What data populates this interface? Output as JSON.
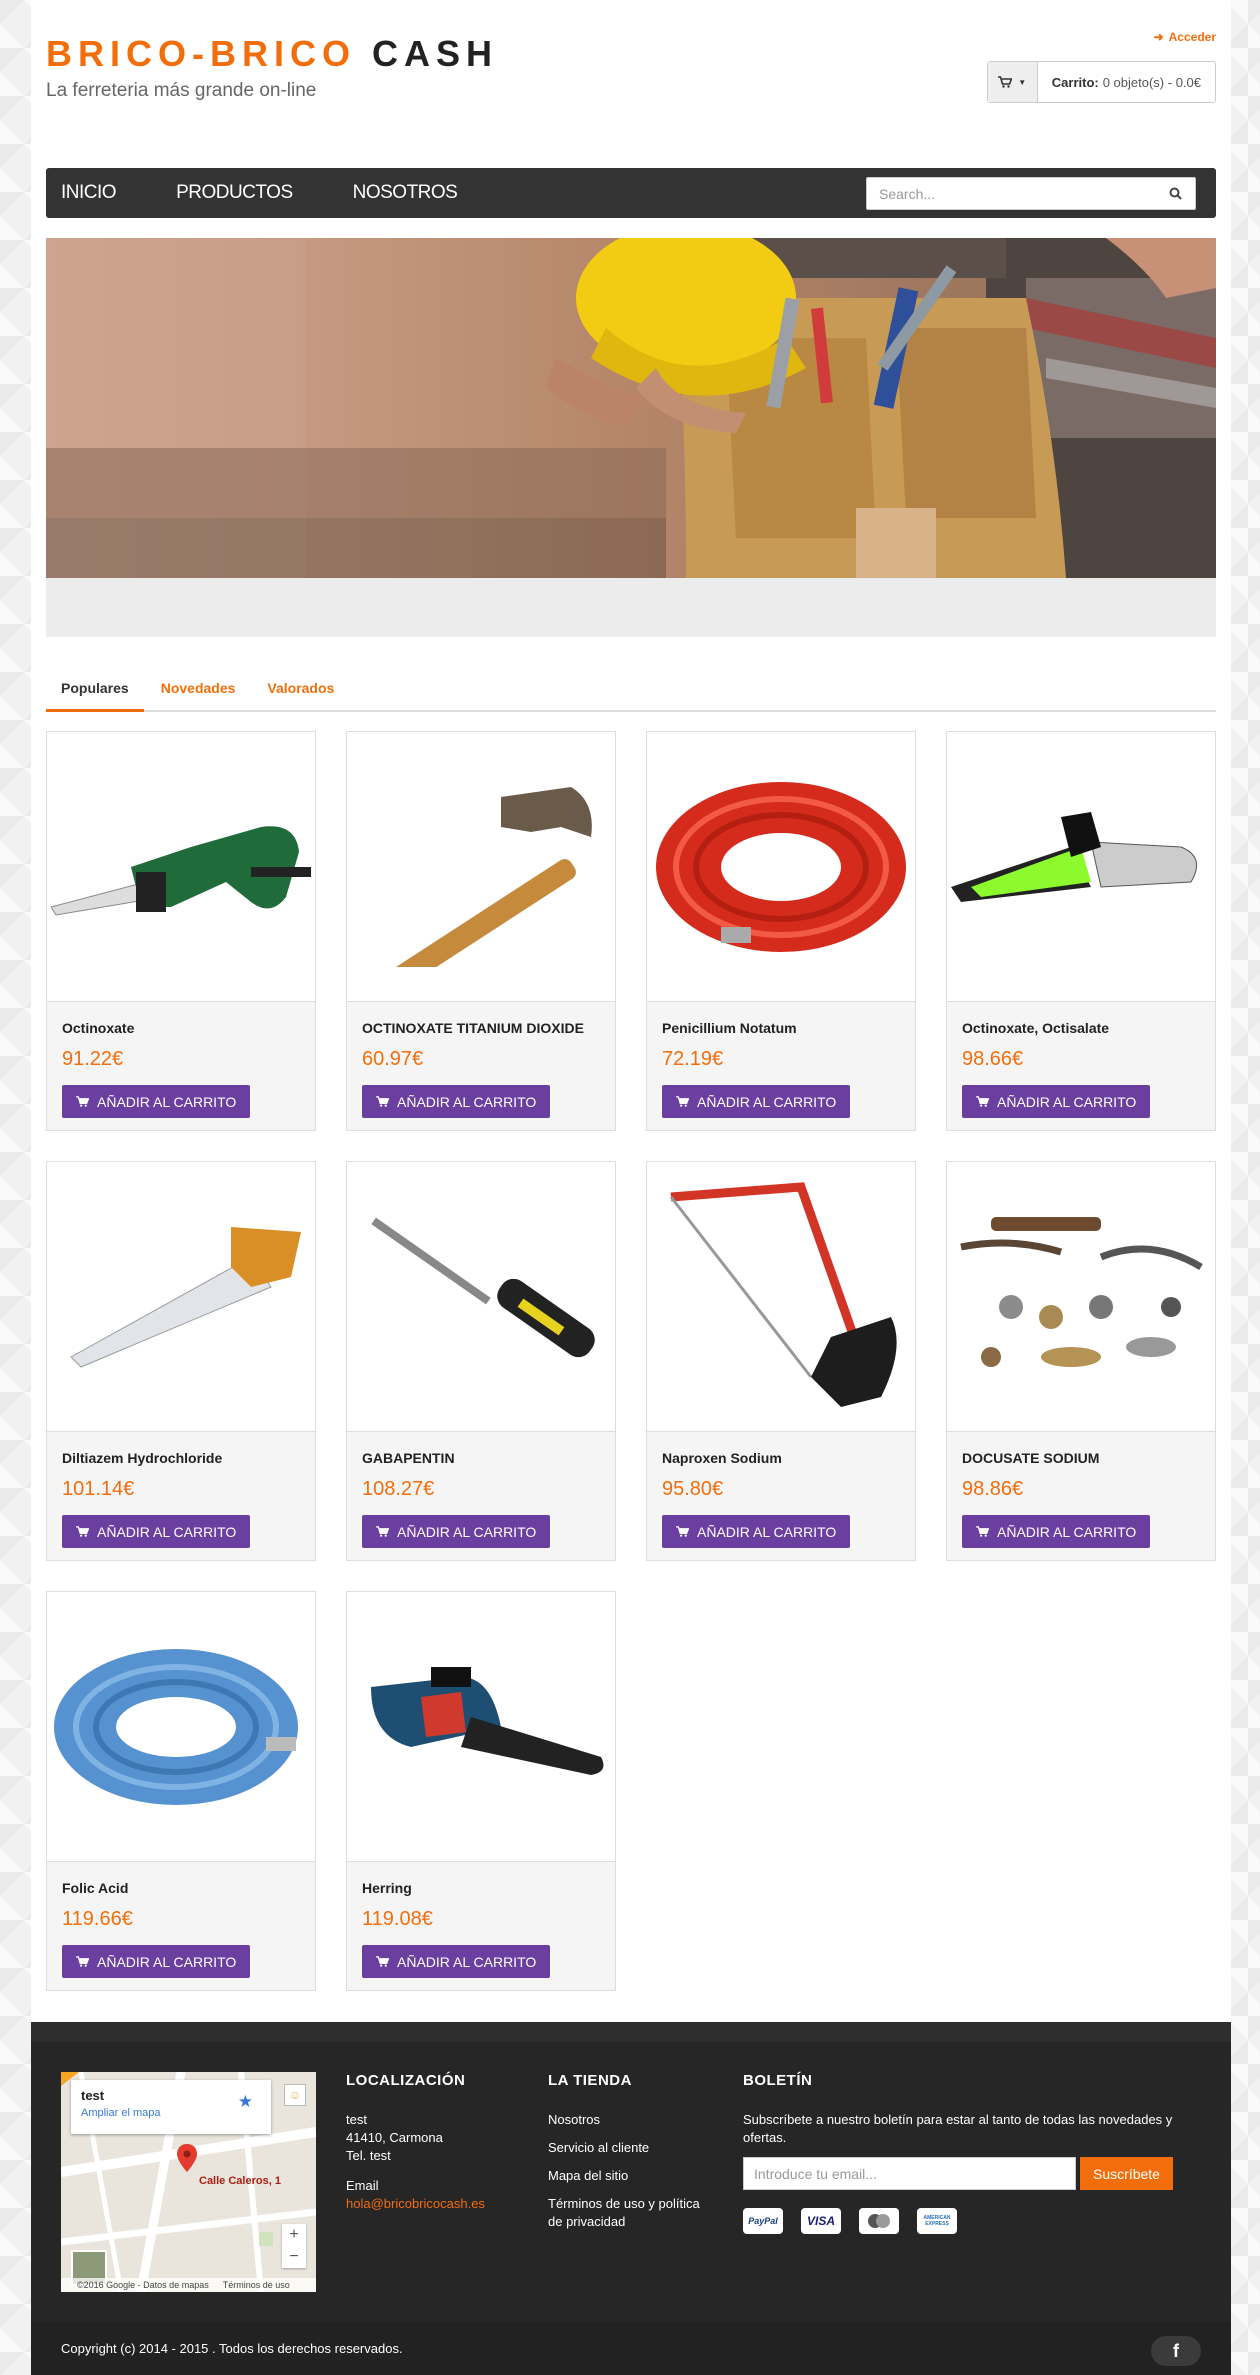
{
  "header": {
    "logo_part1": "BRICO-BRICO",
    "logo_part2": "CASH",
    "tagline": "La ferreteria más grande on-line",
    "login_label": "Acceder",
    "cart_label": "Carrito:",
    "cart_summary": "0 objeto(s) - 0.0€"
  },
  "nav": {
    "items": [
      "INICIO",
      "PRODUCTOS",
      "NOSOTROS"
    ],
    "search_placeholder": "Search..."
  },
  "tabs": [
    "Populares",
    "Novedades",
    "Valorados"
  ],
  "add_to_cart_label": "AÑADIR AL CARRITO",
  "products": [
    {
      "name": "Octinoxate",
      "price": "91.22€",
      "image": "reciprocating-saw"
    },
    {
      "name": "OCTINOXATE TITANIUM DIOXIDE",
      "price": "60.97€",
      "image": "hammer"
    },
    {
      "name": "Penicillium Notatum",
      "price": "72.19€",
      "image": "red-hose"
    },
    {
      "name": "Octinoxate, Octisalate",
      "price": "98.66€",
      "image": "chainsaw-green"
    },
    {
      "name": "Diltiazem Hydrochloride",
      "price": "101.14€",
      "image": "hand-saw"
    },
    {
      "name": "GABAPENTIN",
      "price": "108.27€",
      "image": "screwdriver"
    },
    {
      "name": "Naproxen Sodium",
      "price": "95.80€",
      "image": "hacksaw"
    },
    {
      "name": "DOCUSATE SODIUM",
      "price": "98.86€",
      "image": "cabinet-handles"
    },
    {
      "name": "Folic Acid",
      "price": "119.66€",
      "image": "blue-hose"
    },
    {
      "name": "Herring",
      "price": "119.08€",
      "image": "chainsaw-blue"
    }
  ],
  "footer": {
    "map": {
      "title": "test",
      "link": "Ampliar el mapa",
      "pin_label": "Calle Caleros, 1",
      "attribution": "©2016 Google - Datos de mapas",
      "terms": "Términos de uso",
      "zoom_in": "+",
      "zoom_out": "−"
    },
    "location": {
      "heading": "LOCALIZACIÓN",
      "line1": "test",
      "line2": "41410, Carmona",
      "line3": "Tel. test",
      "email_label": "Email",
      "email": "hola@bricobricocash.es"
    },
    "store": {
      "heading": "LA TIENDA",
      "links": [
        "Nosotros",
        "Servicio al cliente",
        "Mapa del sitio",
        "Términos de uso y política de privacidad"
      ]
    },
    "newsletter": {
      "heading": "BOLETÍN",
      "text": "Subscríbete a nuestro boletín para estar al tanto de todas las novedades y ofertas.",
      "placeholder": "Introduce tu email...",
      "button": "Suscríbete"
    },
    "payments": [
      "PayPal",
      "VISA",
      "MasterCard",
      "AMERICAN EXPRESS"
    ],
    "copyright": "Copyright (c) 2014 - 2015 . Todos los derechos reservados.",
    "social": "f"
  },
  "colors": {
    "accent": "#f26e0d",
    "button": "#6b3fa0",
    "nav": "#333333",
    "footer": "#262626"
  }
}
